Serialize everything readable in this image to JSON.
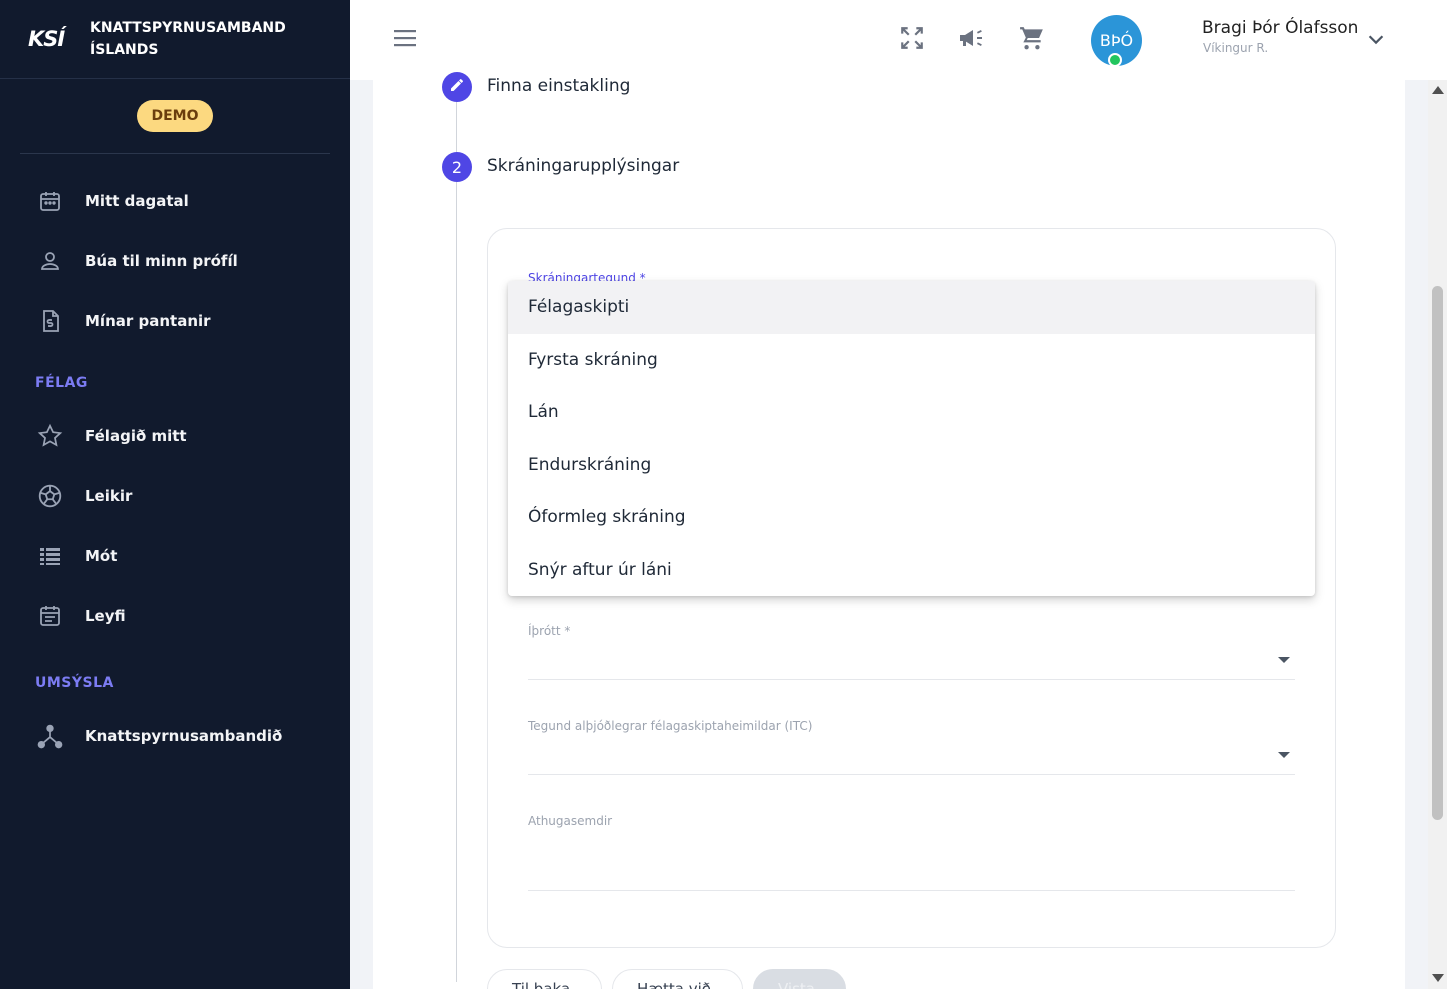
{
  "brand": {
    "logo": "KSÍ",
    "name_line1": "KNATTSPYRNUSAMBAND",
    "name_line2": "ÍSLANDS"
  },
  "badge": "DEMO",
  "sidebar": {
    "items_top": [
      {
        "label": "Mitt dagatal",
        "icon": "calendar-icon"
      },
      {
        "label": "Búa til minn prófíl",
        "icon": "person-icon"
      },
      {
        "label": "Mínar pantanir",
        "icon": "invoice-icon"
      }
    ],
    "section_felag": "FÉLAG",
    "items_felag": [
      {
        "label": "Félagið mitt",
        "icon": "star-icon"
      },
      {
        "label": "Leikir",
        "icon": "soccer-ball-icon"
      },
      {
        "label": "Mót",
        "icon": "table-list-icon"
      },
      {
        "label": "Leyfi",
        "icon": "document-calendar-icon"
      }
    ],
    "section_umsysla": "UMSÝSLA",
    "items_umsysla": [
      {
        "label": "Knattspyrnusambandið",
        "icon": "hub-icon"
      }
    ]
  },
  "topbar": {
    "avatar_initials": "BÞÓ",
    "user_name": "Bragi Þór Ólafsson",
    "user_club": "Víkingur R."
  },
  "steps": [
    {
      "label": "Finna einstakling",
      "state": "done"
    },
    {
      "number": "2",
      "label": "Skráningarupplýsingar",
      "state": "active"
    }
  ],
  "form": {
    "registration_type_label": "Skráningartegund *",
    "registration_type_options": [
      "Félagaskipti",
      "Fyrsta skráning",
      "Lán",
      "Endurskráning",
      "Óformleg skráning",
      "Snýr aftur úr láni"
    ],
    "selected_option": "Félagaskipti",
    "sport_label": "Íþrótt *",
    "itc_label": "Tegund alþjóðlegrar félagaskiptaheimildar (ITC)",
    "comments_label": "Athugasemdir"
  },
  "actions": {
    "back": "Til baka",
    "cancel": "Hætta við",
    "submit": "Vista"
  },
  "colors": {
    "sidebar_bg": "#111a2d",
    "accent": "#4f46e5",
    "section_heading": "#7c7cf3",
    "demo_badge": "#fcd980",
    "avatar_bg": "#2b95d8",
    "online": "#22c55e"
  }
}
